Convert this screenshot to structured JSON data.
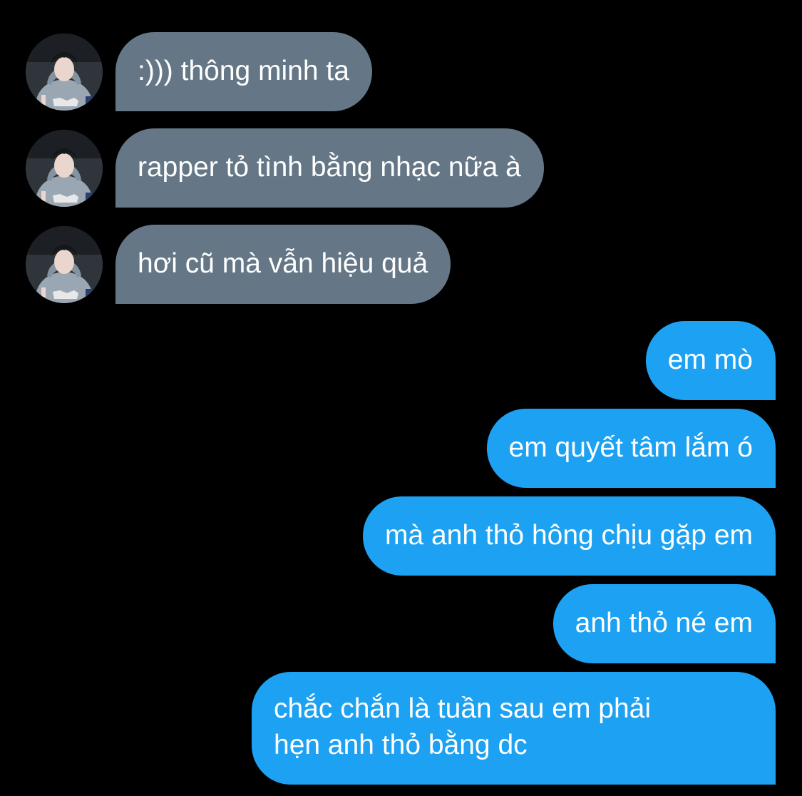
{
  "colors": {
    "background": "#000000",
    "incoming_bubble": "#657786",
    "outgoing_bubble": "#1da1f2",
    "text": "#ffffff"
  },
  "contact": {
    "avatar_icon": "profile-photo-icon"
  },
  "messages": [
    {
      "direction": "incoming",
      "text": ":))) thông minh ta"
    },
    {
      "direction": "incoming",
      "text": "rapper tỏ tình bằng nhạc nữa à"
    },
    {
      "direction": "incoming",
      "text": "hơi cũ mà vẫn hiệu quả"
    },
    {
      "direction": "outgoing",
      "text": "em mò"
    },
    {
      "direction": "outgoing",
      "text": "em quyết tâm lắm ó"
    },
    {
      "direction": "outgoing",
      "text": "mà anh thỏ hông chịu gặp em"
    },
    {
      "direction": "outgoing",
      "text": "anh thỏ né em"
    },
    {
      "direction": "outgoing",
      "text_line1": "chắc chắn là tuần sau em phải",
      "text_line2": "hẹn anh thỏ bằng dc"
    }
  ]
}
